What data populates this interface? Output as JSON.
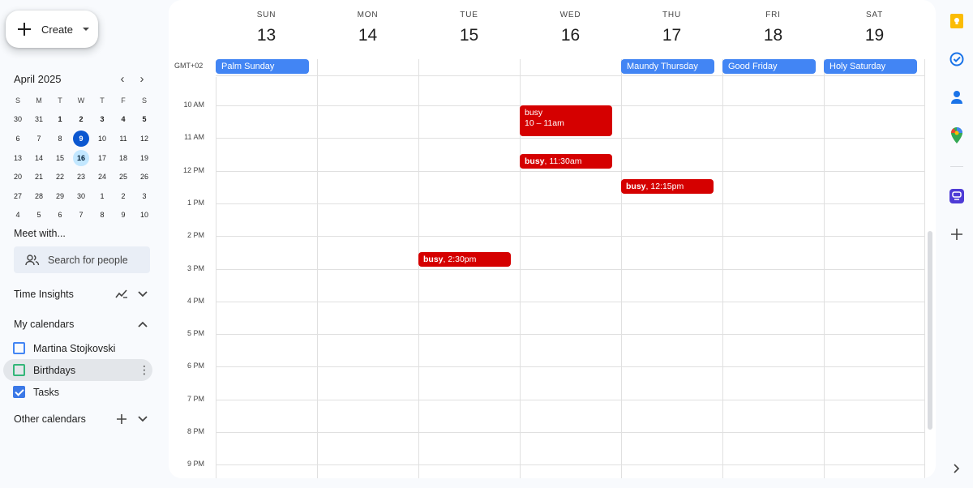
{
  "sidebar": {
    "create_label": "Create",
    "mini_calendar": {
      "month_label": "April 2025",
      "weekdays": [
        "S",
        "M",
        "T",
        "W",
        "T",
        "F",
        "S"
      ],
      "weeks": [
        [
          "30",
          "31",
          "1",
          "2",
          "3",
          "4",
          "5"
        ],
        [
          "6",
          "7",
          "8",
          "9",
          "10",
          "11",
          "12"
        ],
        [
          "13",
          "14",
          "15",
          "16",
          "17",
          "18",
          "19"
        ],
        [
          "20",
          "21",
          "22",
          "23",
          "24",
          "25",
          "26"
        ],
        [
          "27",
          "28",
          "29",
          "30",
          "1",
          "2",
          "3"
        ],
        [
          "4",
          "5",
          "6",
          "7",
          "8",
          "9",
          "10"
        ]
      ],
      "today": "9",
      "selected": "16"
    },
    "meet_title": "Meet with...",
    "people_search_placeholder": "Search for people",
    "time_insights_label": "Time Insights",
    "my_calendars_label": "My calendars",
    "my_calendars": [
      {
        "name": "Martina Stojkovski",
        "color": "#4285f4",
        "checked": false
      },
      {
        "name": "Birthdays",
        "color": "#33b679",
        "checked": false
      },
      {
        "name": "Tasks",
        "color": "#3b78e7",
        "checked": true
      }
    ],
    "other_calendars_label": "Other calendars"
  },
  "week": {
    "timezone": "GMT+02",
    "days": [
      {
        "dow": "SUN",
        "num": "13"
      },
      {
        "dow": "MON",
        "num": "14"
      },
      {
        "dow": "TUE",
        "num": "15"
      },
      {
        "dow": "WED",
        "num": "16"
      },
      {
        "dow": "THU",
        "num": "17"
      },
      {
        "dow": "FRI",
        "num": "18"
      },
      {
        "dow": "SAT",
        "num": "19"
      }
    ],
    "all_day_events": [
      {
        "day": 0,
        "title": "Palm Sunday"
      },
      {
        "day": 4,
        "title": "Maundy Thursday"
      },
      {
        "day": 5,
        "title": "Good Friday"
      },
      {
        "day": 6,
        "title": "Holy Saturday"
      }
    ],
    "hours": [
      "10 AM",
      "11 AM",
      "12 PM",
      "1 PM",
      "2 PM",
      "3 PM",
      "4 PM",
      "5 PM",
      "6 PM",
      "7 PM",
      "8 PM",
      "9 PM"
    ],
    "events": [
      {
        "day": 3,
        "start": 10,
        "end": 11,
        "title": "busy",
        "time": "10 – 11am",
        "layout": "two-line"
      },
      {
        "day": 3,
        "start": 11.5,
        "end": 12,
        "title": "busy",
        "time": "11:30am",
        "layout": "inline"
      },
      {
        "day": 4,
        "start": 12.25,
        "end": 12.75,
        "title": "busy",
        "time": "12:15pm",
        "layout": "inline"
      },
      {
        "day": 2,
        "start": 14.5,
        "end": 15,
        "title": "busy",
        "time": "2:30pm",
        "layout": "inline"
      }
    ],
    "event_color": "#d50000",
    "holiday_color": "#4285f4"
  },
  "rail": {
    "icons": [
      "keep-icon",
      "tasks-icon",
      "contacts-icon",
      "maps-icon",
      "extension-icon",
      "add-icon",
      "expand-icon"
    ]
  }
}
